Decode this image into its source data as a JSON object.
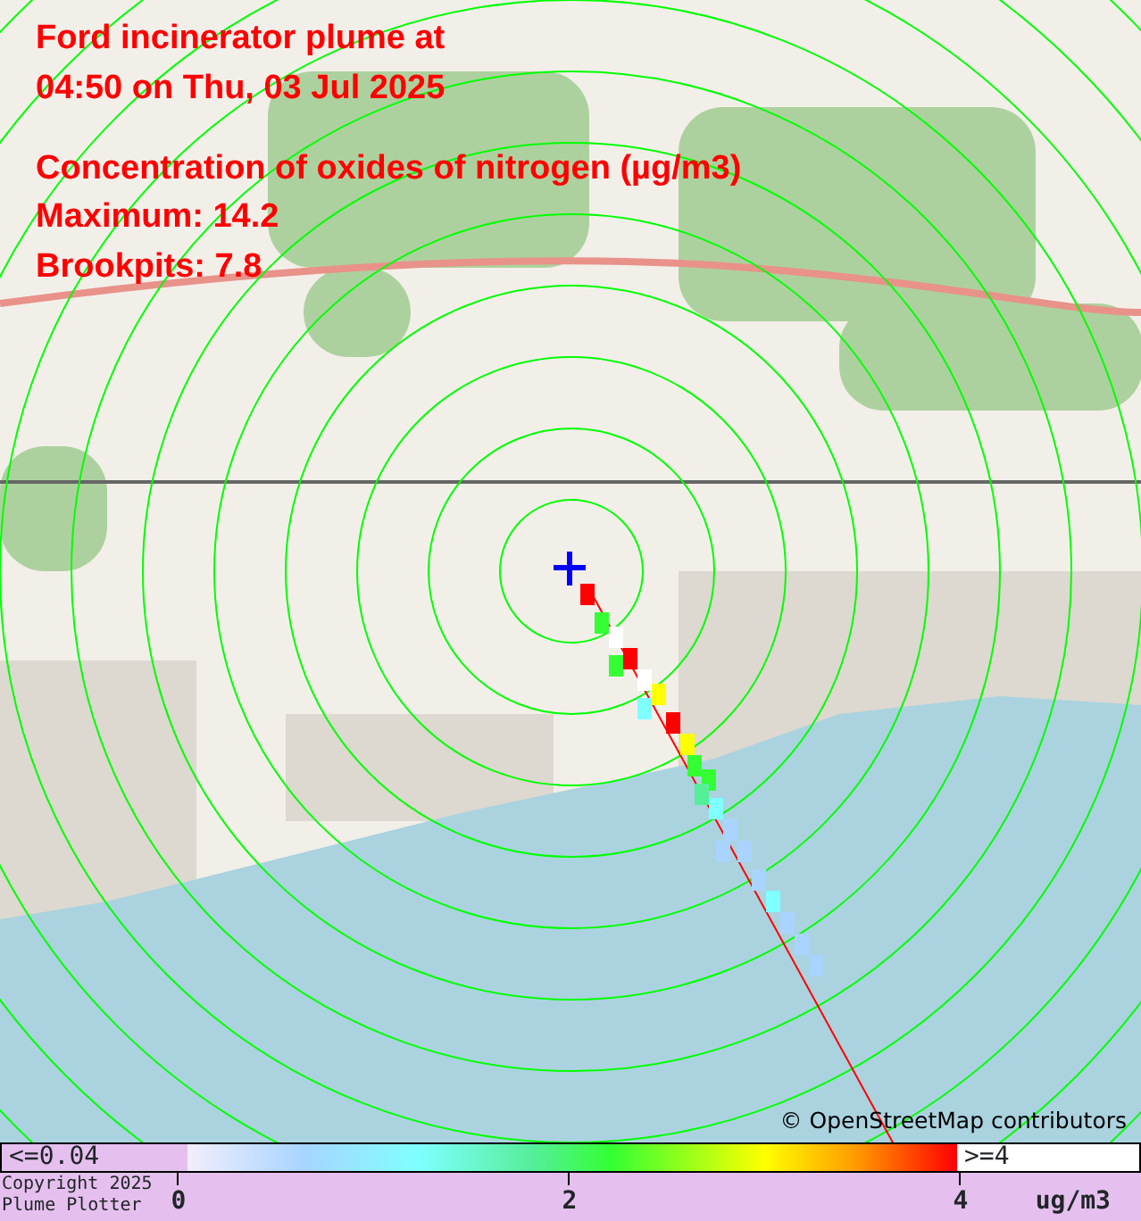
{
  "overlay": {
    "title_lines": [
      "Ford incinerator plume at",
      "04:50 on Thu, 03 Jul 2025"
    ],
    "pollutant": "Concentration of oxides of nitrogen (µg/m3)",
    "maximum": "Maximum: 14.2",
    "site_reading": "Brookpits: 7.8"
  },
  "attribution": "© OpenStreetMap contributors",
  "legend": {
    "below_label": "<=0.04",
    "above_label": ">=4",
    "ticks": [
      "0",
      "2",
      "4"
    ],
    "unit": "ug/m3"
  },
  "copyright_lines": [
    "Copyright 2025",
    "Plume Plotter"
  ]
}
